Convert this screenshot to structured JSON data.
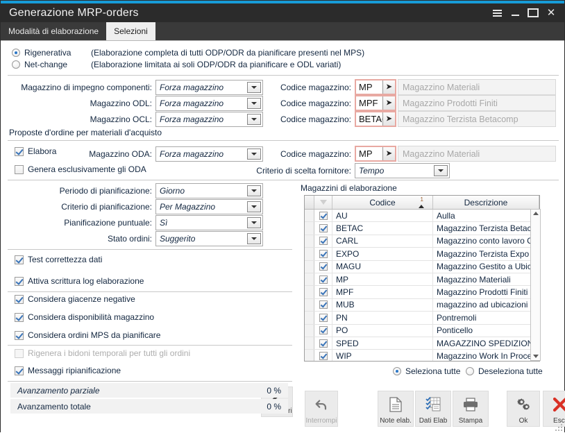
{
  "window": {
    "title": "Generazione MRP-orders",
    "accent_color": "#179cd8",
    "titlebar_color": "#2b2b2b",
    "controls": [
      "menu-icon",
      "minimize-icon",
      "maximize-icon",
      "close-icon"
    ]
  },
  "tabs": [
    {
      "label": "Modalità di elaborazione",
      "active": false
    },
    {
      "label": "Selezioni",
      "active": true
    }
  ],
  "mode": {
    "options": [
      {
        "label": "Rigenerativa",
        "selected": true,
        "note": "(Elaborazione completa di tutti ODP/ODR da pianificare presenti nel MPS)"
      },
      {
        "label": "Net-change",
        "selected": false,
        "note": "(Elaborazione limitata ai soli ODP/ODR da pianificare e ODL variati)"
      }
    ]
  },
  "warehouses": {
    "rows": [
      {
        "label": "Magazzino di impegno componenti:",
        "combo": "Forza magazzino",
        "code_label": "Codice magazzino:",
        "code": "MP",
        "desc": "Magazzino Materiali"
      },
      {
        "label": "Magazzino ODL:",
        "combo": "Forza magazzino",
        "code_label": "Codice magazzino:",
        "code": "MPF",
        "desc": "Magazzino Prodotti Finiti"
      },
      {
        "label": "Magazzino OCL:",
        "combo": "Forza magazzino",
        "code_label": "Codice magazzino:",
        "code": "BETAC",
        "desc": "Magazzino Terzista Betacomp"
      }
    ]
  },
  "purchase": {
    "caption": "Proposte d'ordine per materiali d'acquisto",
    "elabora": {
      "label": "Elabora",
      "checked": true
    },
    "genera": {
      "label": "Genera esclusivamente gli ODA",
      "checked": false
    },
    "oda_label": "Magazzino ODA:",
    "oda_combo": "Forza magazzino",
    "code_label": "Codice magazzino:",
    "code": "MP",
    "desc": "Magazzino Materiali",
    "criterio_label": "Criterio di scelta fornitore:",
    "criterio_value": "Tempo"
  },
  "planning": {
    "rows": [
      {
        "label": "Periodo di pianificazione:",
        "value": "Giorno"
      },
      {
        "label": "Criterio di pianificazione:",
        "value": "Per Magazzino"
      },
      {
        "label": "Pianificazione puntuale:",
        "value": "Sì"
      },
      {
        "label": "Stato ordini:",
        "value": "Suggerito"
      }
    ]
  },
  "options": [
    {
      "label": "Test correttezza dati",
      "checked": true,
      "enabled": true
    },
    {
      "label": "Attiva scrittura log elaborazione",
      "checked": true,
      "enabled": true
    },
    {
      "label": "Considera giacenze negative",
      "checked": true,
      "enabled": true
    },
    {
      "label": "Considera disponibilità magazzino",
      "checked": true,
      "enabled": true
    },
    {
      "label": "Considera ordini MPS da pianificare",
      "checked": true,
      "enabled": true
    },
    {
      "label": "Rigenera i bidoni temporali per tutti gli ordini",
      "checked": false,
      "enabled": false
    },
    {
      "label": "Messaggi ripianificazione",
      "checked": true,
      "enabled": true
    }
  ],
  "parametri_button": {
    "label": "Parametri",
    "icon": "wrench-icon"
  },
  "grid": {
    "caption": "Magazzini di elaborazione",
    "headers": {
      "filter": "filter-funnel-icon",
      "codice": "Codice",
      "descrizione": "Descrizione",
      "sort_order": "1"
    },
    "rows": [
      {
        "checked": true,
        "codice": "AU",
        "descrizione": "Aulla"
      },
      {
        "checked": true,
        "codice": "BETAC",
        "descrizione": "Magazzino Terzista Betacomp"
      },
      {
        "checked": true,
        "codice": "CARL",
        "descrizione": "Magazzino conto lavoro Carli"
      },
      {
        "checked": true,
        "codice": "EXPO",
        "descrizione": "Magazzino Terzista Expo"
      },
      {
        "checked": true,
        "codice": "MAGU",
        "descrizione": "Magazzino Gestito a Ubicazioni"
      },
      {
        "checked": true,
        "codice": "MP",
        "descrizione": "Magazzino Materiali"
      },
      {
        "checked": true,
        "codice": "MPF",
        "descrizione": "Magazzino Prodotti Finiti"
      },
      {
        "checked": true,
        "codice": "MUB",
        "descrizione": "magazzino ad ubicazioni"
      },
      {
        "checked": true,
        "codice": "PN",
        "descrizione": "Pontremoli"
      },
      {
        "checked": true,
        "codice": "PO",
        "descrizione": "Ponticello"
      },
      {
        "checked": true,
        "codice": "SPED",
        "descrizione": "MAGAZZINO SPEDIZIONI"
      },
      {
        "checked": true,
        "codice": "WIP",
        "descrizione": "Magazzino Work In Process"
      }
    ],
    "select_all": {
      "label": "Seleziona tutte",
      "selected": true
    },
    "deselect_all": {
      "label": "Deseleziona tutte",
      "selected": false
    }
  },
  "progress": [
    {
      "label": "Avanzamento parziale",
      "value": "0 %"
    },
    {
      "label": "Avanzamento totale",
      "value": "0 %"
    }
  ],
  "toolbar": [
    {
      "label": "Interrompi",
      "icon": "undo-arrow-icon",
      "enabled": false
    },
    {
      "label": "Note elab.",
      "icon": "document-icon",
      "enabled": true
    },
    {
      "label": "Dati Elab",
      "icon": "checklist-grid-icon",
      "enabled": true
    },
    {
      "label": "Stampa",
      "icon": "printer-icon",
      "enabled": true
    },
    {
      "label": "Ok",
      "icon": "gears-icon",
      "enabled": true
    },
    {
      "label": "Esci",
      "icon": "red-x-icon",
      "enabled": true
    }
  ]
}
